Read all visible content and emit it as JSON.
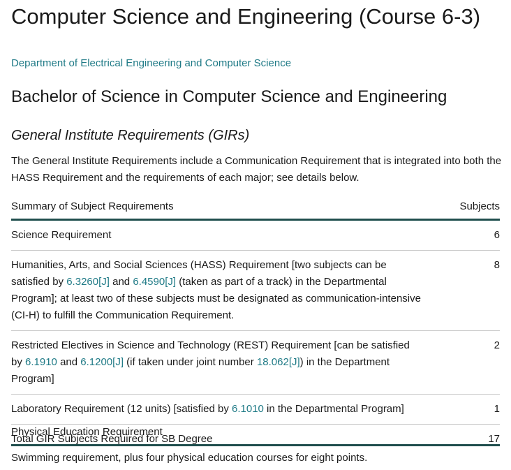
{
  "page": {
    "title": "Computer Science and Engineering (Course 6-3)",
    "department_link": "Department of Electrical Engineering and Computer Science",
    "degree_heading": "Bachelor of Science in Computer Science and Engineering",
    "gir_heading": "General Institute Requirements (GIRs)",
    "gir_intro": "The General Institute Requirements include a Communication Requirement that is integrated into both the HASS Requirement and the requirements of each major; see details below."
  },
  "table": {
    "col_summary": "Summary of Subject Requirements",
    "col_subjects": "Subjects",
    "rows": [
      {
        "segments": [
          {
            "text": "Science Requirement"
          }
        ],
        "value": "6"
      },
      {
        "segments": [
          {
            "text": "Humanities, Arts, and Social Sciences (HASS) Requirement [two subjects can be satisfied by "
          },
          {
            "text": "6.3260[J]",
            "link": true
          },
          {
            "text": " and "
          },
          {
            "text": "6.4590[J]",
            "link": true
          },
          {
            "text": " (taken as part of a track) in the Departmental Program]; at least two of these subjects must be designated as communication-intensive (CI-H) to fulfill the Communication Requirement."
          }
        ],
        "value": "8"
      },
      {
        "segments": [
          {
            "text": "Restricted Electives in Science and Technology (REST) Requirement [can be satisfied by "
          },
          {
            "text": "6.1910",
            "link": true
          },
          {
            "text": " and "
          },
          {
            "text": "6.1200[J]",
            "link": true
          },
          {
            "text": " (if taken under joint number "
          },
          {
            "text": "18.062[J]",
            "link": true
          },
          {
            "text": ") in the Department Program]"
          }
        ],
        "value": "2"
      },
      {
        "segments": [
          {
            "text": "Laboratory Requirement (12 units) [satisfied by "
          },
          {
            "text": "6.1010",
            "link": true
          },
          {
            "text": " in the Departmental Program]"
          }
        ],
        "value": "1"
      }
    ],
    "total_label": "Total GIR Subjects Required for SB Degree",
    "total_value": "17"
  },
  "pe": {
    "heading": "Physical Education Requirement",
    "text": "Swimming requirement, plus four physical education courses for eight points."
  },
  "colors": {
    "link": "#1f7a86",
    "rule": "#1f4e4d"
  }
}
